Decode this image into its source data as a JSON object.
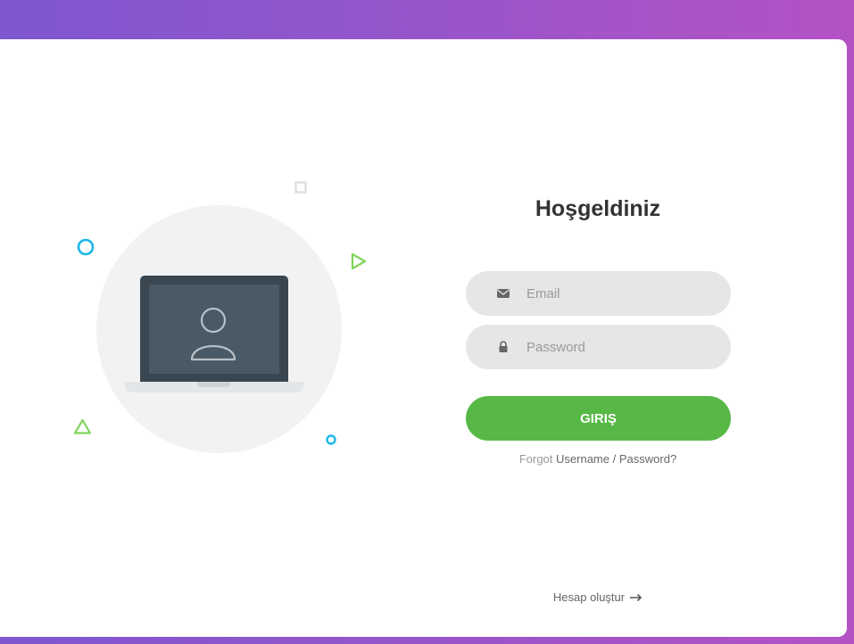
{
  "login": {
    "title": "Hoşgeldiniz",
    "email_placeholder": "Email",
    "password_placeholder": "Password",
    "submit_label": "GIRIŞ",
    "forgot_prefix": "Forgot",
    "forgot_username": "Username",
    "forgot_separator": "/",
    "forgot_password": "Password?",
    "create_account": "Hesap oluştur"
  },
  "icons": {
    "email": "envelope-icon",
    "password": "lock-icon",
    "create_arrow": "arrow-right-icon",
    "illustration": "laptop-user-icon"
  },
  "colors": {
    "background_start": "#7e57d1",
    "background_end": "#b452c4",
    "button": "#57b846",
    "field_bg": "#e6e6e6",
    "title": "#333333",
    "accent_blue": "#1ab7ea",
    "accent_green": "#7fd45a"
  }
}
